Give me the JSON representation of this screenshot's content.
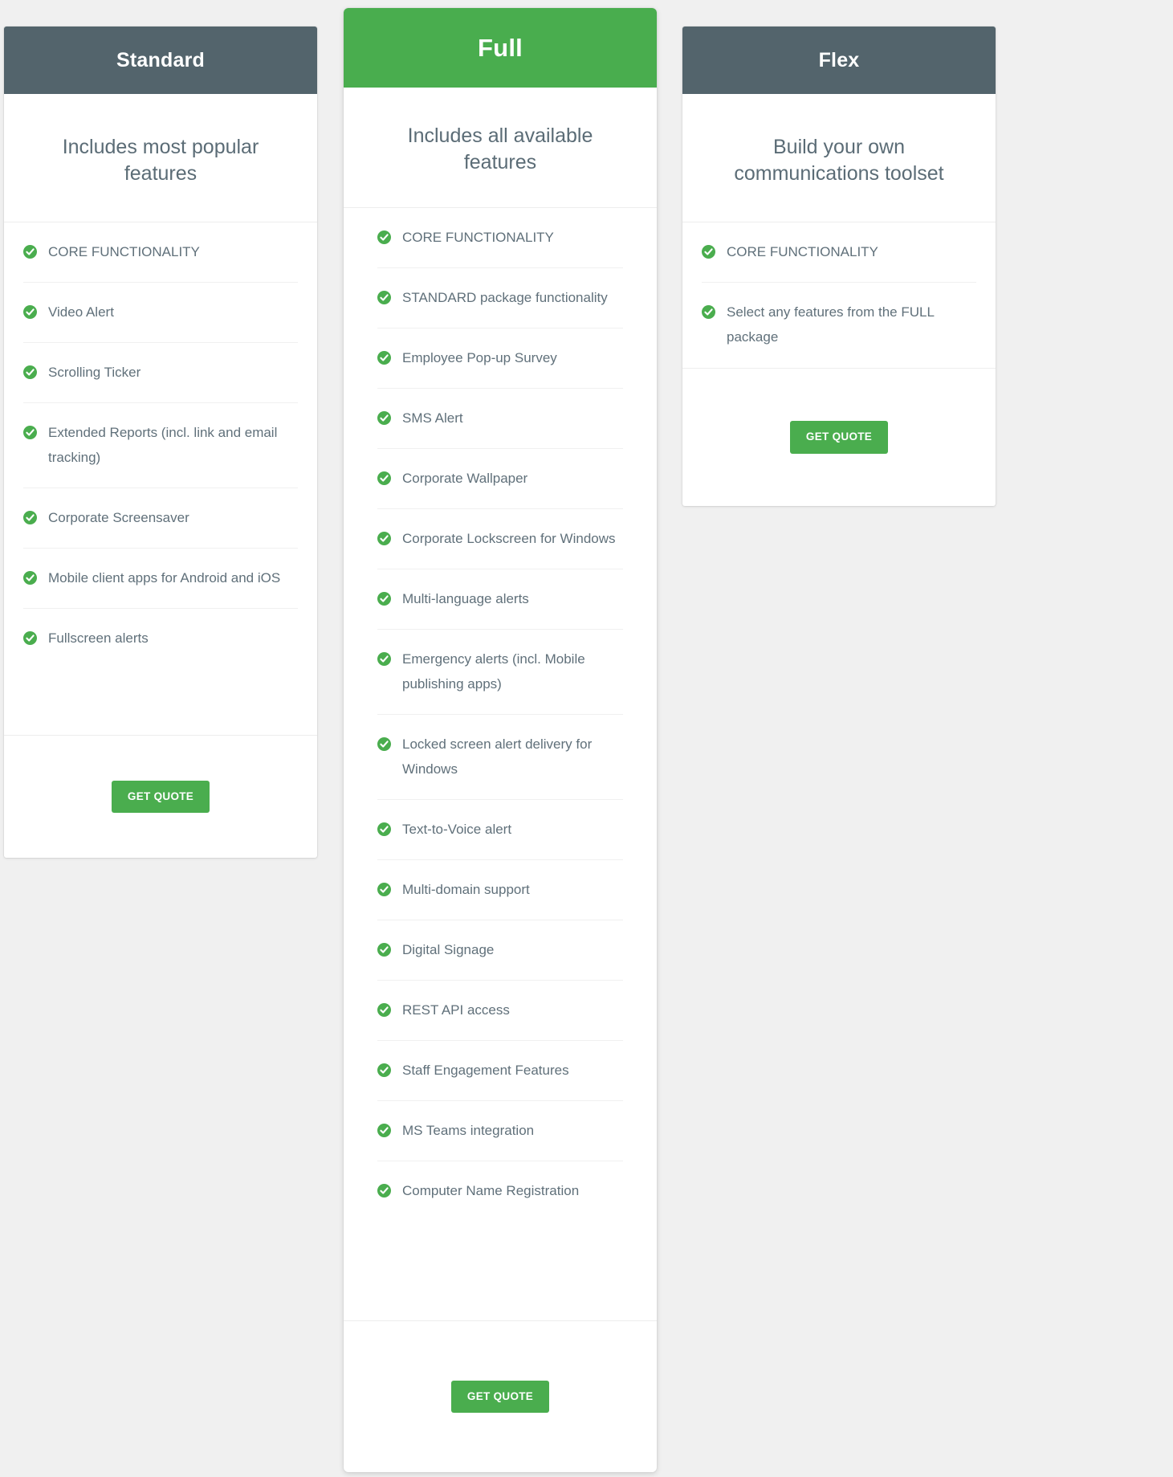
{
  "page": {
    "background_color": "#f0f0f0",
    "accent_green": "#4aad4e",
    "header_slate": "#53646c",
    "text_color": "#60707a"
  },
  "icons": {
    "check": "check-circle-icon"
  },
  "plans": [
    {
      "id": "standard",
      "title": "Standard",
      "highlighted": false,
      "tagline": "Includes most popular features",
      "cta_label": "GET QUOTE",
      "features": [
        "CORE FUNCTIONALITY",
        "Video Alert",
        "Scrolling Ticker",
        "Extended Reports (incl. link and email tracking)",
        "Corporate Screensaver",
        "Mobile client apps for Android and iOS",
        "Fullscreen alerts"
      ]
    },
    {
      "id": "full",
      "title": "Full",
      "highlighted": true,
      "tagline": "Includes all available features",
      "cta_label": "GET QUOTE",
      "features": [
        "CORE FUNCTIONALITY",
        "STANDARD package functionality",
        "Employee Pop-up Survey",
        "SMS Alert",
        "Corporate Wallpaper",
        "Corporate Lockscreen for Windows",
        "Multi-language alerts",
        "Emergency alerts (incl. Mobile publishing apps)",
        "Locked screen alert delivery for Windows",
        "Text-to-Voice alert",
        "Multi-domain support",
        "Digital Signage",
        "REST API access",
        "Staff Engagement Features",
        "MS Teams integration",
        "Computer Name Registration"
      ]
    },
    {
      "id": "flex",
      "title": "Flex",
      "highlighted": false,
      "tagline": "Build your own communications toolset",
      "cta_label": "GET QUOTE",
      "features": [
        "CORE FUNCTIONALITY",
        "Select any features from the FULL package"
      ]
    }
  ]
}
